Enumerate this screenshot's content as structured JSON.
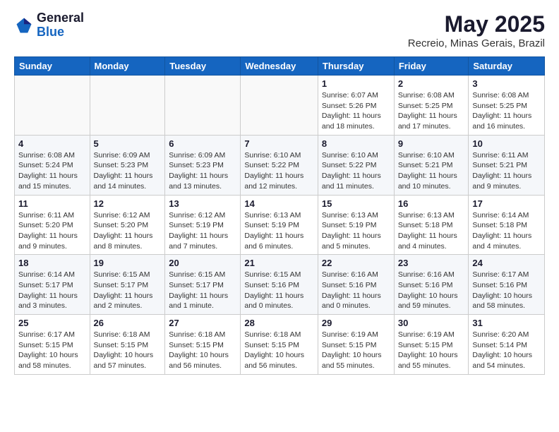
{
  "header": {
    "logo": {
      "line1": "General",
      "line2": "Blue"
    },
    "month": "May 2025",
    "location": "Recreio, Minas Gerais, Brazil"
  },
  "weekdays": [
    "Sunday",
    "Monday",
    "Tuesday",
    "Wednesday",
    "Thursday",
    "Friday",
    "Saturday"
  ],
  "weeks": [
    [
      {
        "day": "",
        "info": ""
      },
      {
        "day": "",
        "info": ""
      },
      {
        "day": "",
        "info": ""
      },
      {
        "day": "",
        "info": ""
      },
      {
        "day": "1",
        "info": "Sunrise: 6:07 AM\nSunset: 5:26 PM\nDaylight: 11 hours and 18 minutes."
      },
      {
        "day": "2",
        "info": "Sunrise: 6:08 AM\nSunset: 5:25 PM\nDaylight: 11 hours and 17 minutes."
      },
      {
        "day": "3",
        "info": "Sunrise: 6:08 AM\nSunset: 5:25 PM\nDaylight: 11 hours and 16 minutes."
      }
    ],
    [
      {
        "day": "4",
        "info": "Sunrise: 6:08 AM\nSunset: 5:24 PM\nDaylight: 11 hours and 15 minutes."
      },
      {
        "day": "5",
        "info": "Sunrise: 6:09 AM\nSunset: 5:23 PM\nDaylight: 11 hours and 14 minutes."
      },
      {
        "day": "6",
        "info": "Sunrise: 6:09 AM\nSunset: 5:23 PM\nDaylight: 11 hours and 13 minutes."
      },
      {
        "day": "7",
        "info": "Sunrise: 6:10 AM\nSunset: 5:22 PM\nDaylight: 11 hours and 12 minutes."
      },
      {
        "day": "8",
        "info": "Sunrise: 6:10 AM\nSunset: 5:22 PM\nDaylight: 11 hours and 11 minutes."
      },
      {
        "day": "9",
        "info": "Sunrise: 6:10 AM\nSunset: 5:21 PM\nDaylight: 11 hours and 10 minutes."
      },
      {
        "day": "10",
        "info": "Sunrise: 6:11 AM\nSunset: 5:21 PM\nDaylight: 11 hours and 9 minutes."
      }
    ],
    [
      {
        "day": "11",
        "info": "Sunrise: 6:11 AM\nSunset: 5:20 PM\nDaylight: 11 hours and 9 minutes."
      },
      {
        "day": "12",
        "info": "Sunrise: 6:12 AM\nSunset: 5:20 PM\nDaylight: 11 hours and 8 minutes."
      },
      {
        "day": "13",
        "info": "Sunrise: 6:12 AM\nSunset: 5:19 PM\nDaylight: 11 hours and 7 minutes."
      },
      {
        "day": "14",
        "info": "Sunrise: 6:13 AM\nSunset: 5:19 PM\nDaylight: 11 hours and 6 minutes."
      },
      {
        "day": "15",
        "info": "Sunrise: 6:13 AM\nSunset: 5:19 PM\nDaylight: 11 hours and 5 minutes."
      },
      {
        "day": "16",
        "info": "Sunrise: 6:13 AM\nSunset: 5:18 PM\nDaylight: 11 hours and 4 minutes."
      },
      {
        "day": "17",
        "info": "Sunrise: 6:14 AM\nSunset: 5:18 PM\nDaylight: 11 hours and 4 minutes."
      }
    ],
    [
      {
        "day": "18",
        "info": "Sunrise: 6:14 AM\nSunset: 5:17 PM\nDaylight: 11 hours and 3 minutes."
      },
      {
        "day": "19",
        "info": "Sunrise: 6:15 AM\nSunset: 5:17 PM\nDaylight: 11 hours and 2 minutes."
      },
      {
        "day": "20",
        "info": "Sunrise: 6:15 AM\nSunset: 5:17 PM\nDaylight: 11 hours and 1 minute."
      },
      {
        "day": "21",
        "info": "Sunrise: 6:15 AM\nSunset: 5:16 PM\nDaylight: 11 hours and 0 minutes."
      },
      {
        "day": "22",
        "info": "Sunrise: 6:16 AM\nSunset: 5:16 PM\nDaylight: 11 hours and 0 minutes."
      },
      {
        "day": "23",
        "info": "Sunrise: 6:16 AM\nSunset: 5:16 PM\nDaylight: 10 hours and 59 minutes."
      },
      {
        "day": "24",
        "info": "Sunrise: 6:17 AM\nSunset: 5:16 PM\nDaylight: 10 hours and 58 minutes."
      }
    ],
    [
      {
        "day": "25",
        "info": "Sunrise: 6:17 AM\nSunset: 5:15 PM\nDaylight: 10 hours and 58 minutes."
      },
      {
        "day": "26",
        "info": "Sunrise: 6:18 AM\nSunset: 5:15 PM\nDaylight: 10 hours and 57 minutes."
      },
      {
        "day": "27",
        "info": "Sunrise: 6:18 AM\nSunset: 5:15 PM\nDaylight: 10 hours and 56 minutes."
      },
      {
        "day": "28",
        "info": "Sunrise: 6:18 AM\nSunset: 5:15 PM\nDaylight: 10 hours and 56 minutes."
      },
      {
        "day": "29",
        "info": "Sunrise: 6:19 AM\nSunset: 5:15 PM\nDaylight: 10 hours and 55 minutes."
      },
      {
        "day": "30",
        "info": "Sunrise: 6:19 AM\nSunset: 5:15 PM\nDaylight: 10 hours and 55 minutes."
      },
      {
        "day": "31",
        "info": "Sunrise: 6:20 AM\nSunset: 5:14 PM\nDaylight: 10 hours and 54 minutes."
      }
    ]
  ]
}
